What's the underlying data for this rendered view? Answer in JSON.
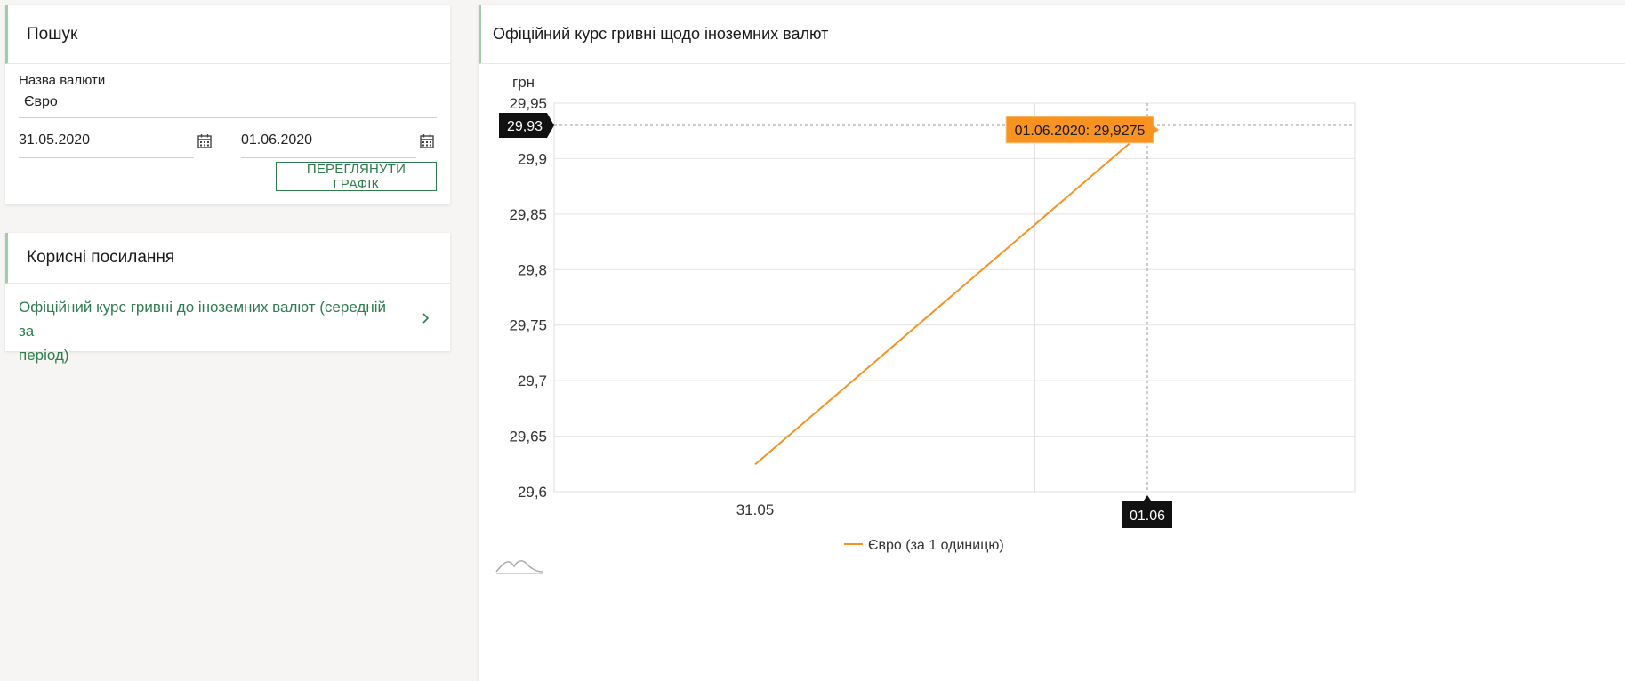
{
  "search": {
    "title": "Пошук",
    "currency_label": "Назва валюти",
    "currency_value": "Євро",
    "date_from": "31.05.2020",
    "date_to": "01.06.2020",
    "view_button": "ПЕРЕГЛЯНУТИ ГРАФІК"
  },
  "useful_links": {
    "title": "Корисні посилання",
    "items": [
      {
        "label_line1": "Офіційний курс гривні до іноземних валют (середній за",
        "label_line2": "період)"
      }
    ]
  },
  "chart_panel": {
    "title": "Офіційний курс гривні щодо іноземних валют"
  },
  "colors": {
    "accent_green": "#2e7d4f",
    "series_orange": "#f7931e",
    "tooltip_black": "#111111"
  },
  "icons": [
    "calendar-icon",
    "chevron-right-icon",
    "highcharts-logo-icon"
  ],
  "chart_data": {
    "type": "line",
    "ylabel": "грн",
    "yticks": [
      "29,6",
      "29,65",
      "29,7",
      "29,75",
      "29,8",
      "29,85",
      "29,9",
      "29,95"
    ],
    "ylim": [
      29.6,
      29.95
    ],
    "x": [
      "31.05",
      "01.06"
    ],
    "series": [
      {
        "name": "Євро (за 1 одиницю)",
        "values": [
          29.6245,
          29.9275
        ]
      }
    ],
    "grid": true,
    "legend": "bottom",
    "crosshair": {
      "y_label": "29,93",
      "x_label": "01.06",
      "tooltip": "01.06.2020: 29,9275"
    }
  }
}
